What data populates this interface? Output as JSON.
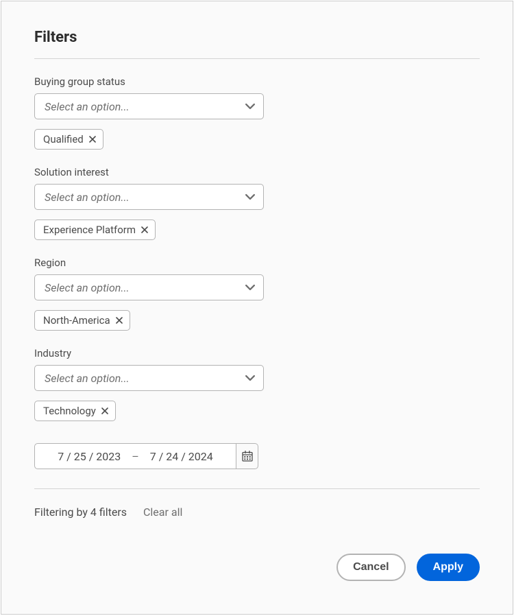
{
  "panel": {
    "title": "Filters"
  },
  "filters": {
    "status": {
      "label": "Buying group status",
      "placeholder": "Select an option...",
      "tags": [
        "Qualified"
      ]
    },
    "solution": {
      "label": "Solution interest",
      "placeholder": "Select an option...",
      "tags": [
        "Experience Platform"
      ]
    },
    "region": {
      "label": "Region",
      "placeholder": "Select an option...",
      "tags": [
        "North-America"
      ]
    },
    "industry": {
      "label": "Industry",
      "placeholder": "Select an option...",
      "tags": [
        "Technology"
      ]
    }
  },
  "dateRange": {
    "start": "7 / 25 / 2023",
    "end": "7 / 24 / 2024",
    "separator": "–"
  },
  "summary": {
    "text": "Filtering by 4 filters",
    "clearAll": "Clear all"
  },
  "actions": {
    "cancel": "Cancel",
    "apply": "Apply"
  },
  "colors": {
    "primary": "#0265dc",
    "border": "#b3b3b3",
    "textMuted": "#6e6e6e",
    "text": "#4b4b4b"
  }
}
